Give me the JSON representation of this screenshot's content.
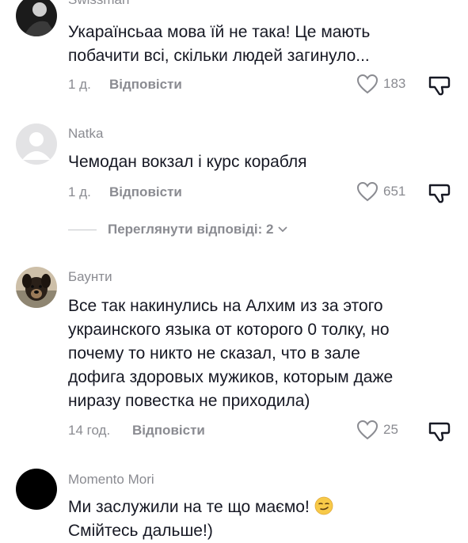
{
  "comments": [
    {
      "username": "Swissman",
      "text_lines": [
        "Укараїнсьаа мова їй не така! Це мають",
        "побачити всі, скільки людей загинуло..."
      ],
      "time": "1 д.",
      "reply_label": "Відповісти",
      "likes": "183"
    },
    {
      "username": "Natka",
      "text_lines": [
        "Чемодан вокзал і курс корабля"
      ],
      "time": "1 д.",
      "reply_label": "Відповісти",
      "likes": "651"
    },
    {
      "username": "Баунти",
      "text_lines": [
        "Все так накинулись на Алхим из за этого",
        "украинского языка от которого 0 толку, но",
        "почему то никто не сказал, что в зале",
        "дофига здоровых мужиков, которым даже",
        "ниразу повестка не приходила)"
      ],
      "time": "14 год.",
      "reply_label": "Відповісти",
      "likes": "25"
    },
    {
      "username": "Momento Mori",
      "text_lines": [
        "Ми заслужили на те що маємо!",
        "Смійтесь дальше!)"
      ],
      "emoji": "smirking-face"
    }
  ],
  "view_replies": {
    "label": "Переглянути відповіді: 2"
  },
  "colors": {
    "text": "#161823",
    "secondary": "#8a8b91",
    "background": "#ffffff"
  }
}
